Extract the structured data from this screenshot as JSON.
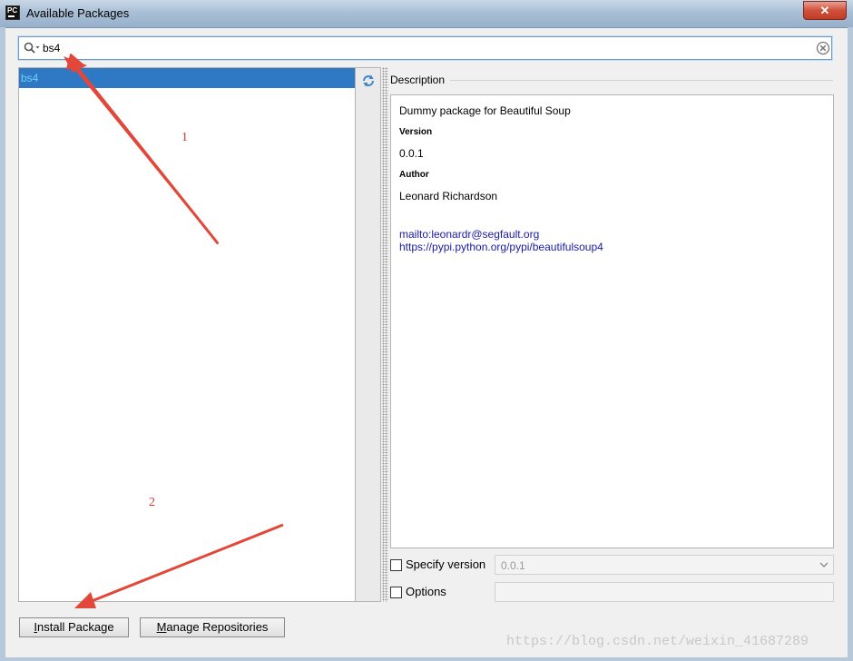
{
  "window": {
    "title": "Available Packages",
    "app_icon_text": "PC",
    "close_symbol": "✕"
  },
  "search": {
    "value": "bs4"
  },
  "packages": [
    {
      "name": "bs4"
    }
  ],
  "description": {
    "heading": "Description",
    "summary": "Dummy package for Beautiful Soup",
    "version_label": "Version",
    "version_value": "0.0.1",
    "author_label": "Author",
    "author_value": "Leonard Richardson",
    "links": [
      "mailto:leonardr@segfault.org",
      "https://pypi.python.org/pypi/beautifulsoup4"
    ]
  },
  "options": {
    "specify_version_label": "Specify version",
    "specify_version_value": "0.0.1",
    "options_label": "Options"
  },
  "buttons": {
    "install_label": "Install Package",
    "manage_label": "Manage Repositories"
  },
  "annotations": {
    "marker_1": "1",
    "marker_2": "2",
    "arrow_color": "#e2473a"
  },
  "watermark": "https://blog.csdn.net/weixin_41687289",
  "icons": {
    "search": "search-icon",
    "clear": "clear-search-icon",
    "reload": "reload-icon",
    "dropdown": "chevron-down-icon",
    "close": "close-icon"
  },
  "colors": {
    "selection": "#2f78c4",
    "link": "#1a1aa6",
    "annotation": "#d23a2c"
  }
}
